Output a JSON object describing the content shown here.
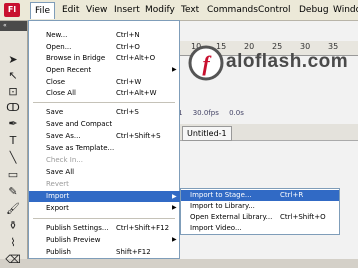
{
  "app": {
    "icon_text": "Fl"
  },
  "menubar": [
    "File",
    "Edit",
    "View",
    "Insert",
    "Modify",
    "Text",
    "Commands",
    "Control",
    "Debug",
    "Windo"
  ],
  "file_menu": [
    {
      "label": "New...",
      "shortcut": "Ctrl+N"
    },
    {
      "label": "Open...",
      "shortcut": "Ctrl+O"
    },
    {
      "label": "Browse in Bridge",
      "shortcut": "Ctrl+Alt+O"
    },
    {
      "label": "Open Recent",
      "shortcut": "",
      "submenu": true
    },
    {
      "label": "Close",
      "shortcut": "Ctrl+W"
    },
    {
      "label": "Close All",
      "shortcut": "Ctrl+Alt+W"
    },
    {
      "label": "Save",
      "shortcut": "Ctrl+S"
    },
    {
      "label": "Save and Compact",
      "shortcut": ""
    },
    {
      "label": "Save As...",
      "shortcut": "Ctrl+Shift+S"
    },
    {
      "label": "Save as Template...",
      "shortcut": ""
    },
    {
      "label": "Check In...",
      "shortcut": "",
      "disabled": true
    },
    {
      "label": "Save All",
      "shortcut": ""
    },
    {
      "label": "Revert",
      "shortcut": "",
      "disabled": true
    },
    {
      "label": "Import",
      "shortcut": "",
      "submenu": true,
      "highlighted": true
    },
    {
      "label": "Export",
      "shortcut": "",
      "submenu": true
    },
    {
      "label": "Publish Settings...",
      "shortcut": "Ctrl+Shift+F12"
    },
    {
      "label": "Publish Preview",
      "shortcut": "",
      "submenu": true
    },
    {
      "label": "Publish",
      "shortcut": "Shift+F12"
    }
  ],
  "import_submenu": [
    {
      "label": "Import to Stage...",
      "shortcut": "Ctrl+R",
      "highlighted": true
    },
    {
      "label": "Import to Library...",
      "shortcut": ""
    },
    {
      "label": "Open External Library...",
      "shortcut": "Ctrl+Shift+O"
    },
    {
      "label": "Import Video...",
      "shortcut": ""
    }
  ],
  "ruler_ticks": [
    "10",
    "15",
    "20",
    "25",
    "30",
    "35"
  ],
  "status": {
    "frame": "1",
    "fps": "30.0fps",
    "time": "0.0s"
  },
  "document_tab": "Untitled-1",
  "watermark": "aloflash.com",
  "colors": {
    "highlight": "#316ac5",
    "app_icon": "#c8102e",
    "menu_border": "#7f9db9"
  }
}
